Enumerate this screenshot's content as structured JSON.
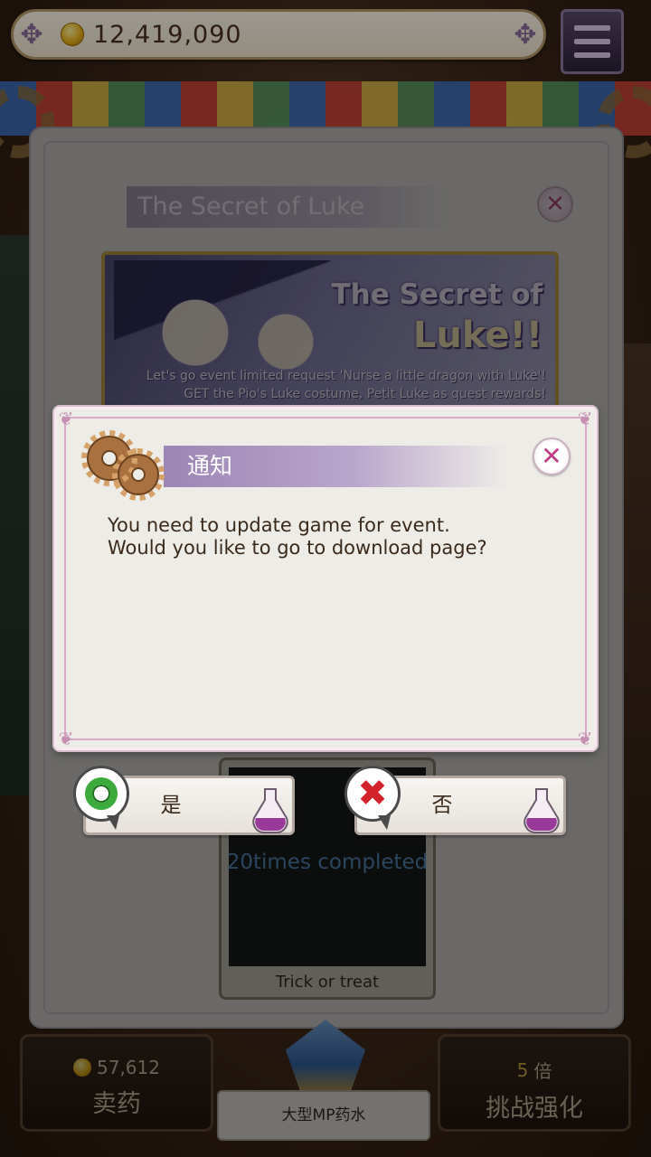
{
  "top_bar": {
    "coins": "12,419,090"
  },
  "event_panel": {
    "title": "The Secret of Luke",
    "banner": {
      "title_line1": "The Secret of",
      "title_line2": "Luke!!",
      "desc_line1": "Let's go event limited request 'Nurse a little dragon with Luke'!",
      "desc_line2": "GET the Pio's Luke costume, Petit Luke as quest rewards!"
    },
    "quest": {
      "progress_text": "20times completed",
      "name": "Trick or treat"
    }
  },
  "dialog": {
    "title": "通知",
    "message_line1": "You need to update game for event.",
    "message_line2": "Would you like to go to download page?",
    "yes_label": "是",
    "no_label": "否"
  },
  "bottom": {
    "sell": {
      "price": "57,612",
      "label": "卖药"
    },
    "potion_name": "大型MP药水",
    "boost": {
      "multiplier_num": "5",
      "multiplier_unit": "倍",
      "label": "挑战强化"
    }
  },
  "colors": {
    "dialog_title_bar": "#9c86b4",
    "close_x": "#c03d86",
    "yes_green": "#3daa3d",
    "no_red": "#d4222a",
    "coin_gold": "#e9b21a"
  },
  "icons": [
    "coin-icon",
    "menu-icon",
    "gear-icon",
    "close-icon",
    "confirm-o-icon",
    "cancel-x-icon",
    "potion-flask-icon"
  ]
}
